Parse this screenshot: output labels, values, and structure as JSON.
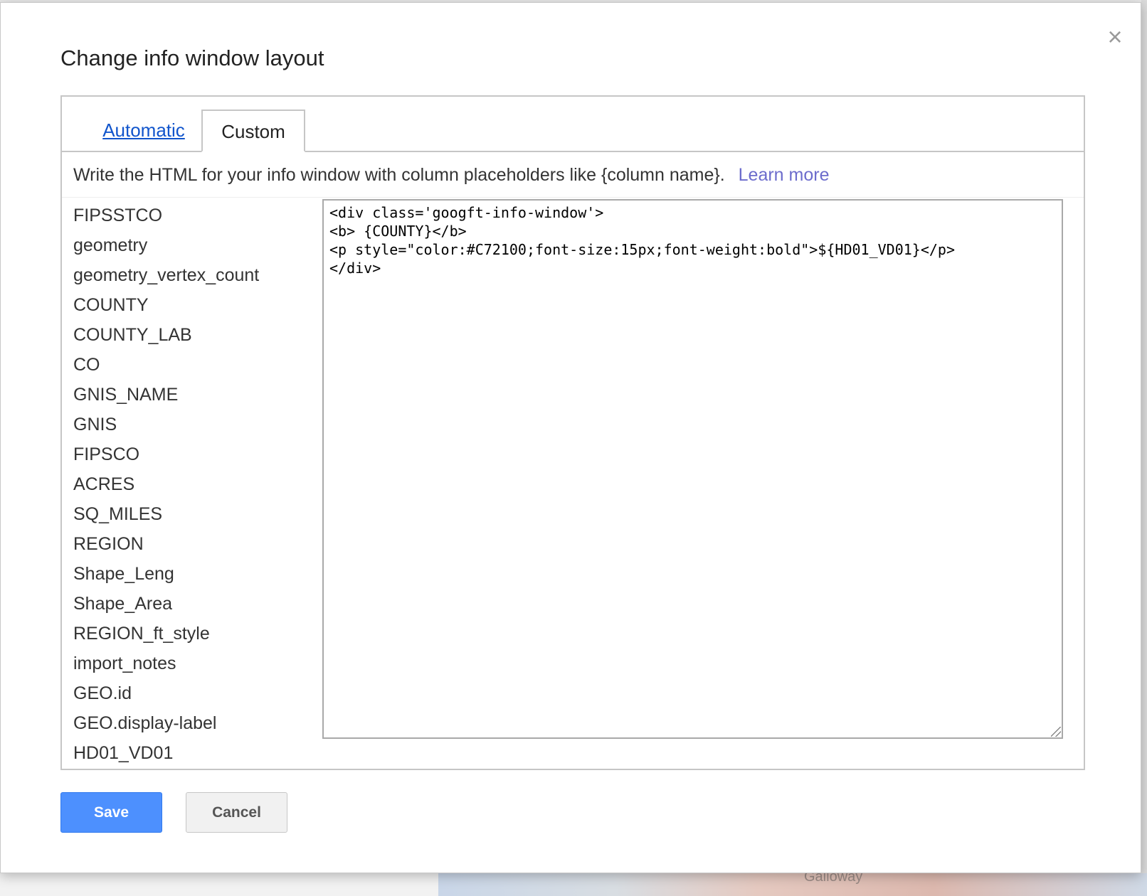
{
  "dialog": {
    "title": "Change info window layout",
    "close_symbol": "×"
  },
  "tabs": [
    {
      "label": "Automatic",
      "active": false
    },
    {
      "label": "Custom",
      "active": true
    }
  ],
  "help": {
    "text": "Write the HTML for your info window with column placeholders like {column name}.",
    "link_label": "Learn more"
  },
  "columns": [
    "FIPSSTCO",
    "geometry",
    "geometry_vertex_count",
    "COUNTY",
    "COUNTY_LAB",
    "CO",
    "GNIS_NAME",
    "GNIS",
    "FIPSCO",
    "ACRES",
    "SQ_MILES",
    "REGION",
    "Shape_Leng",
    "Shape_Area",
    "REGION_ft_style",
    "import_notes",
    "GEO.id",
    "GEO.display-label",
    "HD01_VD01"
  ],
  "editor": {
    "value": "<div class='googft-info-window'>\n<b> {COUNTY}</b>\n<p style=\"color:#C72100;font-size:15px;font-weight:bold\">${HD01_VD01}</p>\n</div>"
  },
  "buttons": {
    "save_label": "Save",
    "cancel_label": "Cancel"
  },
  "background": {
    "map_label": "Galloway"
  },
  "colors": {
    "primary_button": "#4d90fe",
    "link": "#1155cc",
    "learn_more": "#6c6ccc"
  },
  "icons": {
    "close": "close-icon",
    "resize": "resize-grip-icon"
  }
}
